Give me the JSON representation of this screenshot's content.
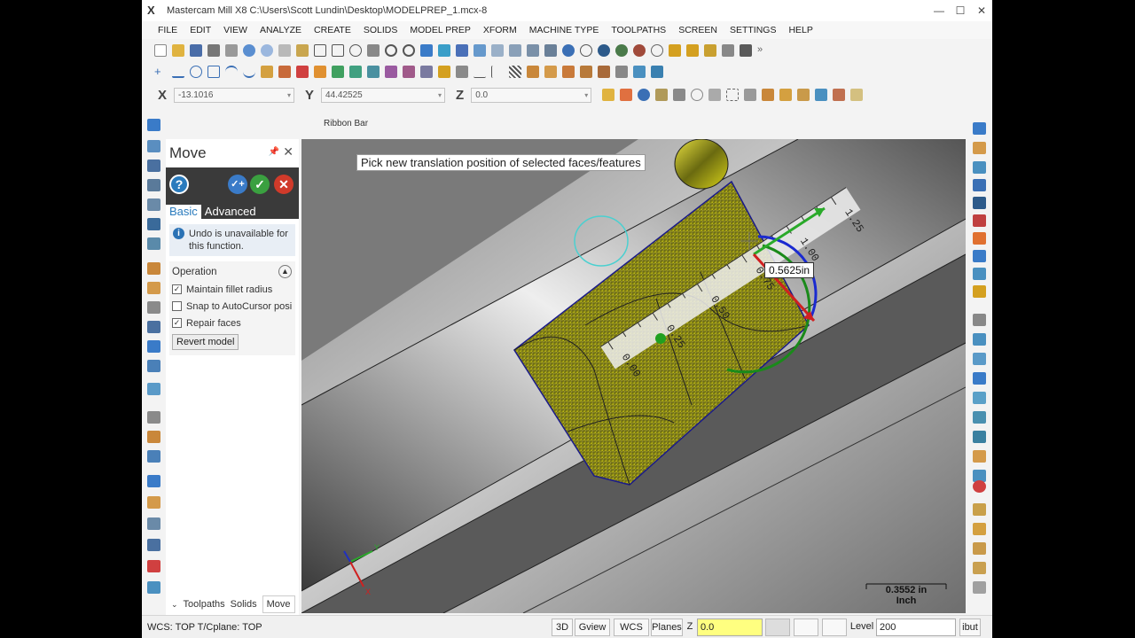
{
  "window": {
    "title": "Mastercam Mill X8  C:\\Users\\Scott Lundin\\Desktop\\MODELPREP_1.mcx-8",
    "logo": "X"
  },
  "menu": [
    "FILE",
    "EDIT",
    "VIEW",
    "ANALYZE",
    "CREATE",
    "SOLIDS",
    "MODEL PREP",
    "XFORM",
    "MACHINE TYPE",
    "TOOLPATHS",
    "SCREEN",
    "SETTINGS",
    "HELP"
  ],
  "coords": {
    "x_label": "X",
    "x_value": "-13.1016",
    "y_label": "Y",
    "y_value": "44.42525",
    "z_label": "Z",
    "z_value": "0.0"
  },
  "ribbon": {
    "label": "Ribbon Bar"
  },
  "panel": {
    "title": "Move",
    "help_icon": "?",
    "tabs": [
      "Basic",
      "Advanced"
    ],
    "info": "Undo is unavailable for this function.",
    "info_icon": "i",
    "section": "Operation",
    "options": [
      {
        "label": "Maintain fillet radius",
        "checked": true
      },
      {
        "label": "Snap to AutoCursor posi",
        "checked": false
      },
      {
        "label": "Repair faces",
        "checked": true
      }
    ],
    "revert_label": "Revert model",
    "bottom_tabs": [
      "Toolpaths",
      "Solids",
      "Move"
    ]
  },
  "viewport": {
    "prompt": "Pick new translation position of selected faces/features",
    "measurement": "0.5625in",
    "ruler_labels": [
      "0.00",
      "0.25",
      "0.50",
      "0.75",
      "1.00",
      "1.25"
    ],
    "scale_value": "0.3552 in",
    "scale_unit": "Inch",
    "axis_x": "X",
    "axis_y": "Y"
  },
  "status": {
    "wcs_text": "WCS: TOP  T/Cplane: TOP",
    "btn_3d": "3D",
    "btn_gview": "Gview",
    "btn_wcs": "WCS",
    "btn_planes": "Planes",
    "z_label": "Z",
    "z_value": "0.0",
    "level_label": "Level",
    "level_value": "200",
    "attrib_label": "ibut"
  },
  "colors": {
    "accent_blue": "#2a7bbd",
    "part_yellow": "#d8d21a",
    "dark_panel": "#3a3a3a"
  }
}
